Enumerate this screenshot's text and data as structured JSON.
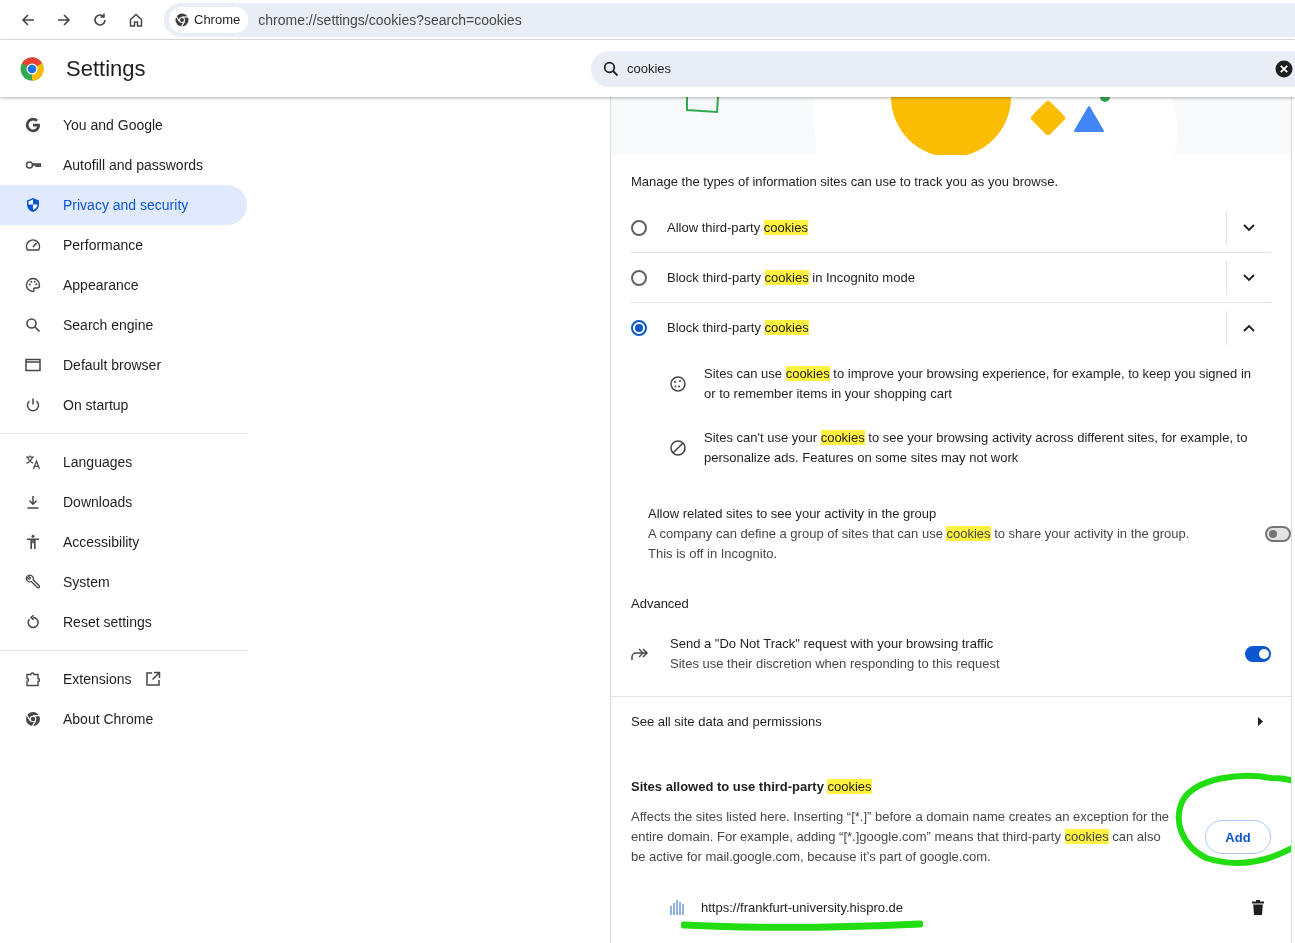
{
  "browser": {
    "chip": "Chrome",
    "url": "chrome://settings/cookies?search=cookies"
  },
  "header": {
    "title": "Settings",
    "search": {
      "value": "cookies"
    }
  },
  "sidebar": {
    "groups": [
      [
        {
          "label": "You and Google",
          "selected": false,
          "opens_externally": false
        },
        {
          "label": "Autofill and passwords",
          "selected": false,
          "opens_externally": false
        },
        {
          "label": "Privacy and security",
          "selected": true,
          "opens_externally": false
        },
        {
          "label": "Performance",
          "selected": false,
          "opens_externally": false
        },
        {
          "label": "Appearance",
          "selected": false,
          "opens_externally": false
        },
        {
          "label": "Search engine",
          "selected": false,
          "opens_externally": false
        },
        {
          "label": "Default browser",
          "selected": false,
          "opens_externally": false
        },
        {
          "label": "On startup",
          "selected": false,
          "opens_externally": false
        }
      ],
      [
        {
          "label": "Languages",
          "selected": false,
          "opens_externally": false
        },
        {
          "label": "Downloads",
          "selected": false,
          "opens_externally": false
        },
        {
          "label": "Accessibility",
          "selected": false,
          "opens_externally": false
        },
        {
          "label": "System",
          "selected": false,
          "opens_externally": false
        },
        {
          "label": "Reset settings",
          "selected": false,
          "opens_externally": false
        }
      ],
      [
        {
          "label": "Extensions",
          "selected": false,
          "opens_externally": true
        },
        {
          "label": "About Chrome",
          "selected": false,
          "opens_externally": false
        }
      ]
    ]
  },
  "cookies": {
    "intro": "Manage the types of information sites can use to track you as you browse.",
    "options": [
      {
        "label": "Allow third-party **cookies**",
        "selected": false,
        "expanded": false
      },
      {
        "label": "Block third-party **cookies** in Incognito mode",
        "selected": false,
        "expanded": false
      },
      {
        "label": "Block third-party **cookies**",
        "selected": true,
        "expanded": true,
        "details": [
          "Sites can use **cookies** to improve your browsing experience, for example, to keep you signed in or to remember items in your shopping cart",
          "Sites can't use your **cookies** to see your browsing activity across different sites, for example, to personalize ads. Features on some sites may not work"
        ]
      }
    ],
    "related_sites": {
      "title": "Allow related sites to see your activity in the group",
      "description": "A company can define a group of sites that can use **cookies** to share your activity in the group.",
      "note": "This is off in Incognito.",
      "on": false
    },
    "advanced": {
      "heading": "Advanced",
      "do_not_track": {
        "title": "Send a \"Do Not Track\" request with your browsing traffic",
        "description": "Sites use their discretion when responding to this request",
        "on": true
      }
    },
    "site_data_link": "See all site data and permissions",
    "allowed_sites": {
      "heading": "Sites allowed to use third-party **cookies**",
      "description": [
        {
          "text": "Affects the sites listed here. Inserting “[*.]” before a domain name creates an exception for the entire domain. For example, adding “[*.]google.com” means that third-party ",
          "highlight": false
        },
        {
          "text": "cookies",
          "highlight": true
        },
        {
          "text": " can also be active for mail.google.com, because it’s part of google.com.",
          "highlight": false
        }
      ],
      "add_button": "Add",
      "sites": [
        {
          "url": "https://frankfurt-university.hispro.de"
        }
      ]
    }
  }
}
